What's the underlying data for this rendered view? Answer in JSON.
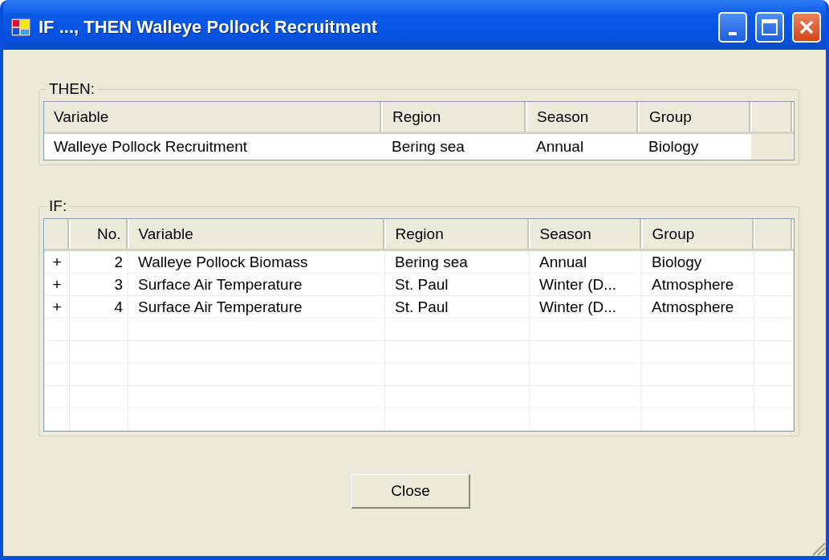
{
  "window": {
    "title": "IF ..., THEN Walleye Pollock Recruitment"
  },
  "then_group": {
    "label": "THEN:",
    "columns": [
      "Variable",
      "Region",
      "Season",
      "Group"
    ],
    "rows": [
      [
        "Walleye Pollock Recruitment",
        "Bering sea",
        "Annual",
        "Biology"
      ]
    ]
  },
  "if_group": {
    "label": "IF:",
    "columns": [
      "",
      "No.",
      "Variable",
      "Region",
      "Season",
      "Group"
    ],
    "rows": [
      [
        "+",
        "2",
        "Walleye Pollock Biomass",
        "Bering sea",
        "Annual",
        "Biology"
      ],
      [
        "+",
        "3",
        "Surface Air Temperature",
        "St. Paul",
        "Winter (D...",
        "Atmosphere"
      ],
      [
        "+",
        "4",
        "Surface Air Temperature",
        "St. Paul",
        "Winter (D...",
        "Atmosphere"
      ]
    ]
  },
  "buttons": [
    "Close"
  ]
}
